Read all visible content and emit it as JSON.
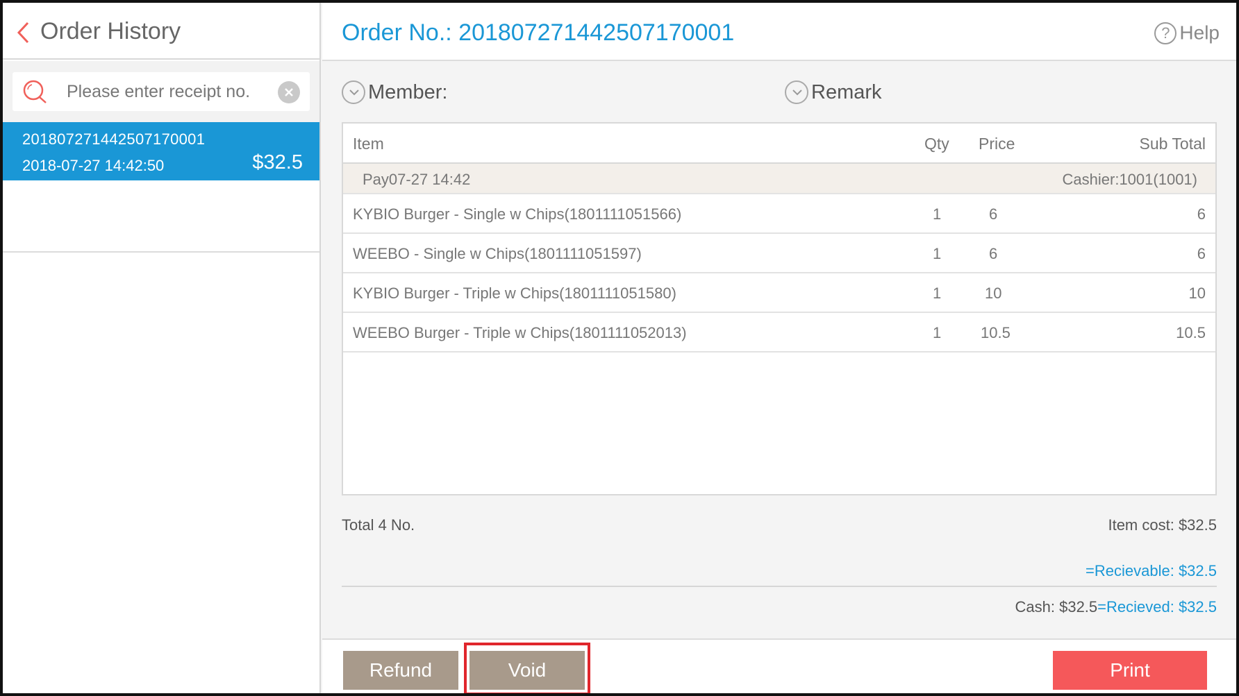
{
  "left_panel": {
    "title": "Order History",
    "search": {
      "placeholder": "Please enter receipt no.",
      "value": ""
    },
    "orders": [
      {
        "order_no": "201807271442507170001",
        "datetime": "2018-07-27 14:42:50",
        "amount": "$32.5",
        "selected": true
      }
    ]
  },
  "header": {
    "order_label": "Order No.: 201807271442507170001",
    "help_label": "Help"
  },
  "toggles": {
    "member": "Member:",
    "remark": "Remark"
  },
  "table": {
    "columns": [
      "Item",
      "Qty",
      "Price",
      "Sub Total"
    ],
    "pay_row": {
      "left": "Pay07-27 14:42",
      "right": "Cashier:1001(1001)"
    },
    "rows": [
      {
        "item": "KYBIO Burger - Single w Chips(1801111051566)",
        "qty": "1",
        "price": "6",
        "subtotal": "6"
      },
      {
        "item": "WEEBO - Single w Chips(1801111051597)",
        "qty": "1",
        "price": "6",
        "subtotal": "6"
      },
      {
        "item": "KYBIO Burger - Triple w Chips(1801111051580)",
        "qty": "1",
        "price": "10",
        "subtotal": "10"
      },
      {
        "item": "WEEBO Burger - Triple w Chips(1801111052013)",
        "qty": "1",
        "price": "10.5",
        "subtotal": "10.5"
      }
    ]
  },
  "summary": {
    "total_no": "Total 4 No.",
    "item_cost": "Item cost: $32.5",
    "receivable": "=Recievable: $32.5",
    "cash": "Cash: $32.5",
    "received": "=Recieved: $32.5"
  },
  "buttons": {
    "refund": "Refund",
    "void": "Void",
    "print": "Print"
  },
  "colors": {
    "accent_blue": "#1a97d6",
    "button_brown": "#a89a8b",
    "print_red": "#f5585a",
    "highlight_red": "#e0262c"
  }
}
